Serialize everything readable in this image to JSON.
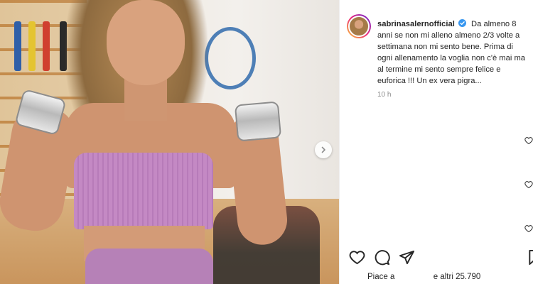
{
  "post": {
    "username": "sabrinasalernofficial",
    "caption": "Da almeno 8 anni se non mi alleno almeno 2/3 volte a settimana non mi sento bene. Prima di ogni allenamento la voglia non c'è mai ma al termine mi sento sempre felice e euforica !!! Un ex vera pigra...",
    "timestamp": "10 h"
  },
  "likes": {
    "prefix": "Piace a",
    "suffix": "e altri 25.790"
  },
  "icons": {
    "verified": "verified-badge-icon",
    "like": "heart-icon",
    "comment": "comment-icon",
    "share": "share-icon",
    "save": "bookmark-icon",
    "next": "chevron-right-icon"
  },
  "colors": {
    "verified": "#3897f0",
    "text": "#262626",
    "muted": "#8e8e8e"
  }
}
